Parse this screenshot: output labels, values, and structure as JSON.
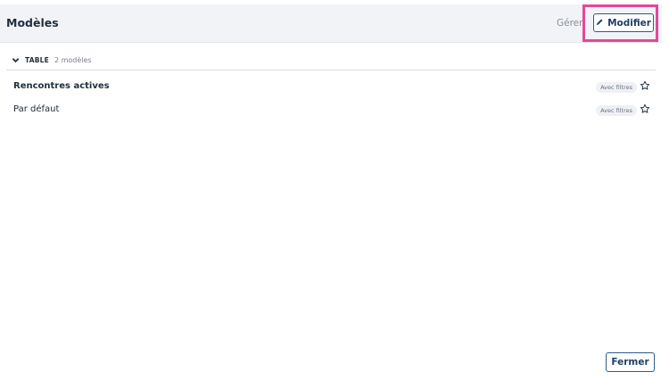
{
  "header": {
    "title": "Modèles",
    "manage_label": "Gérer",
    "edit_label": "Modifier"
  },
  "section": {
    "label": "TABLE",
    "count": "2 modèles"
  },
  "templates": [
    {
      "name": "Rencontres actives",
      "badge": "Avec filtres",
      "bold": true
    },
    {
      "name": "Par défaut",
      "badge": "Avec filtres",
      "bold": false
    }
  ],
  "footer": {
    "close_label": "Fermer"
  },
  "colors": {
    "accent": "#1f3f66",
    "highlight": "#e5479a",
    "header_bg": "#f1f3f6"
  },
  "icons": {
    "edit": "pencil-icon",
    "collapse": "chevron-down-icon",
    "favorite": "star-outline-icon"
  }
}
